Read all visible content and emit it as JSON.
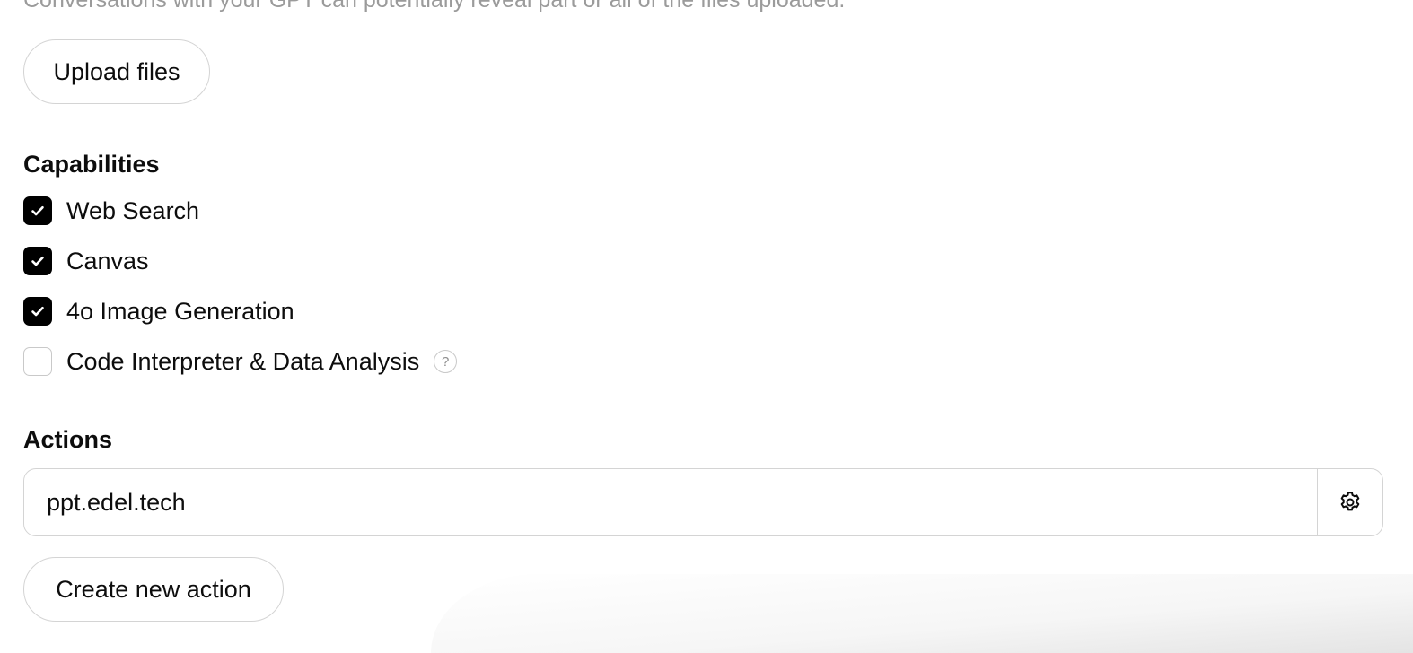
{
  "files_section": {
    "note": "Conversations with your GPT can potentially reveal part or all of the files uploaded.",
    "upload_label": "Upload files"
  },
  "capabilities": {
    "title": "Capabilities",
    "items": [
      {
        "label": "Web Search",
        "checked": true
      },
      {
        "label": "Canvas",
        "checked": true
      },
      {
        "label": "4o Image Generation",
        "checked": true
      },
      {
        "label": "Code Interpreter & Data Analysis",
        "checked": false,
        "help": "?"
      }
    ]
  },
  "actions": {
    "title": "Actions",
    "items": [
      {
        "domain": "ppt.edel.tech",
        "settings_icon": "gear-icon"
      }
    ],
    "create_label": "Create new action"
  }
}
